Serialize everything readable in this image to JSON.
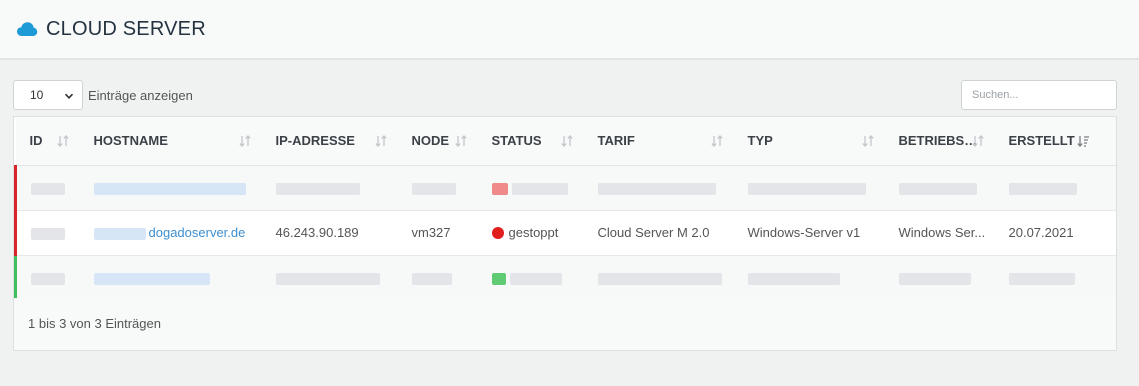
{
  "header": {
    "title": "CLOUD SERVER",
    "icon": "cloud-icon",
    "accent": "#1e9ad6"
  },
  "controls": {
    "page_length": "10",
    "page_length_label": "Einträge anzeigen",
    "search_placeholder": "Suchen..."
  },
  "table": {
    "columns": [
      "ID",
      "HOSTNAME",
      "IP-ADRESSE",
      "NODE",
      "STATUS",
      "TARIF",
      "TYP",
      "BETRIEBS…",
      "ERSTELLT"
    ],
    "rows": [
      {
        "hostname_suffix": "",
        "ip": "",
        "node": "",
        "status": "",
        "tarif": "",
        "typ": "",
        "betriebssystem": "",
        "erstellt": ""
      },
      {
        "hostname_suffix": "dogadoserver.de",
        "ip": "46.243.90.189",
        "node": "vm327",
        "status": "gestoppt",
        "tarif": "Cloud Server M 2.0",
        "typ": "Windows-Server v1",
        "betriebssystem": "Windows Ser...",
        "erstellt": "20.07.2021"
      },
      {
        "hostname_suffix": "",
        "ip": "",
        "node": "",
        "status": "",
        "tarif": "",
        "typ": "",
        "betriebssystem": "",
        "erstellt": ""
      }
    ],
    "status_colors": {
      "stopped": "#d9242c",
      "running": "#3fbf5b"
    }
  },
  "footer": {
    "info": "1 bis 3 von 3 Einträgen"
  }
}
